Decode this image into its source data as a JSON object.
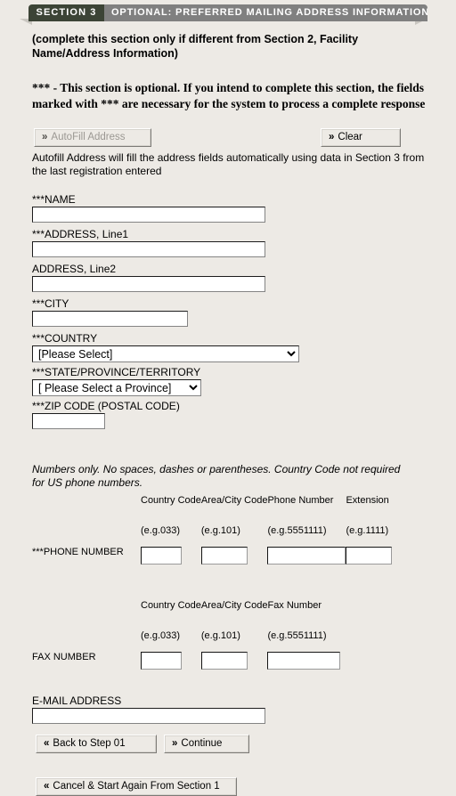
{
  "header": {
    "section_tab": "SECTION  3",
    "section_title": "OPTIONAL: PREFERRED MAILING ADDRESS INFORMATION",
    "tab_dark_color": "#3c4436",
    "tab_light_color": "#808080",
    "page_background": "#edeae5"
  },
  "intro": {
    "text": "(complete this section only if different from Section 2, Facility Name/Address Information)",
    "note": "*** - This section is optional. If you intend to complete this section, the fields marked with *** are necessary for the system to process a complete response"
  },
  "toolbar": {
    "autofill_label": "AutoFill Address",
    "autofill_chevron": "»",
    "autofill_disabled": true,
    "clear_label": "Clear",
    "clear_chevron": "»",
    "autofill_description": "Autofill Address will fill the address fields automatically using data in Section 3 from the last registration entered"
  },
  "address_fields": {
    "name": {
      "label": "***NAME",
      "value": "",
      "placeholder": ""
    },
    "address_line1": {
      "label": "***ADDRESS, Line1",
      "value": "",
      "placeholder": ""
    },
    "address_line2": {
      "label": "ADDRESS, Line2",
      "value": "",
      "placeholder": ""
    },
    "city": {
      "label": "***CITY",
      "value": "",
      "placeholder": ""
    },
    "country": {
      "label": "***COUNTRY",
      "selected": "[Please Select]"
    },
    "state": {
      "label": "***STATE/PROVINCE/TERRITORY",
      "selected": "[ Please Select a Province]"
    },
    "zip": {
      "label": "***ZIP CODE (POSTAL CODE)",
      "value": "",
      "placeholder": ""
    }
  },
  "phone_section": {
    "note": "Numbers only. No spaces, dashes or parentheses. Country Code not required for US phone numbers.",
    "row_label": "***PHONE NUMBER",
    "columns": [
      {
        "header": "Country Code",
        "example": "(e.g.033)",
        "value": ""
      },
      {
        "header": "Area/City Code",
        "example": "(e.g.101)",
        "value": ""
      },
      {
        "header": "Phone Number",
        "example": "(e.g.5551111)",
        "value": ""
      },
      {
        "header": "Extension",
        "example": "(e.g.1111)",
        "value": ""
      }
    ]
  },
  "fax_section": {
    "row_label": "FAX NUMBER",
    "columns": [
      {
        "header": "Country Code",
        "example": "(e.g.033)",
        "value": ""
      },
      {
        "header": "Area/City Code",
        "example": "(e.g.101)",
        "value": ""
      },
      {
        "header": "Fax Number",
        "example": "(e.g.5551111)",
        "value": ""
      }
    ]
  },
  "email_field": {
    "label": "E-MAIL ADDRESS",
    "value": "",
    "placeholder": ""
  },
  "footer": {
    "back_label": "Back to Step 01",
    "back_chevron": "«",
    "continue_label": "Continue",
    "continue_chevron": "»",
    "cancel_label": "Cancel & Start Again From Section 1",
    "cancel_chevron": "«"
  }
}
